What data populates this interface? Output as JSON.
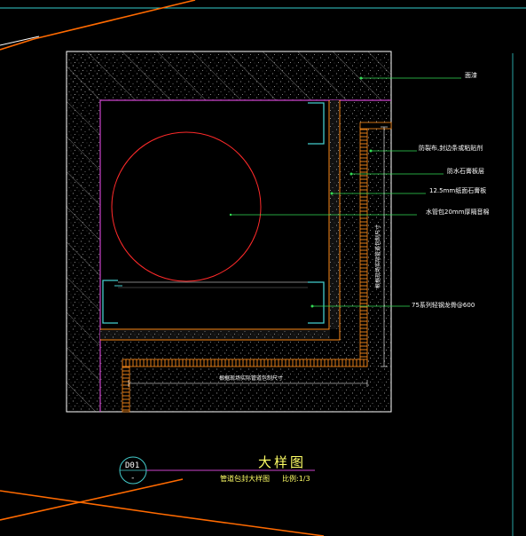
{
  "drawing": {
    "colors": {
      "background": "#000000",
      "frame": "#ffffff",
      "wall_outline": "#cc44cc",
      "pipe": "#ff2a2a",
      "fill_accent": "#ff8c1a",
      "leader": "#33dd55",
      "steel": "#44cccc",
      "title_text": "#ffff66",
      "grid_line": "#ff6a00",
      "top_line": "#33cccc"
    },
    "callouts": [
      "面漆",
      "防裂布,封边条或粘贴剂",
      "防水石膏板层",
      "12.5mm纸面石膏板",
      "水管包20mm厚隔音棉",
      "75系列轻钢龙骨@600"
    ],
    "dimension_vertical": "根据现场实际管道包制尺寸",
    "dimension_horizontal": "根据现场实际管道包制尺寸",
    "detail_tag": {
      "number": "D01",
      "sheet": "-"
    },
    "title": "大样图",
    "subtitle": "管道包封大样图",
    "scale_text": "比例:1/3"
  }
}
